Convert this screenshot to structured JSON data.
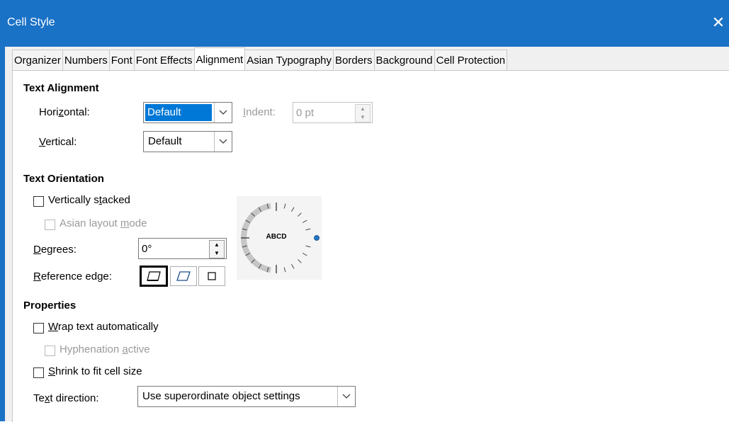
{
  "window": {
    "title": "Cell Style",
    "close_glyph": "✕"
  },
  "tabs": [
    {
      "label": "Organizer"
    },
    {
      "label": "Numbers"
    },
    {
      "label": "Font"
    },
    {
      "label": "Font Effects"
    },
    {
      "label": "Alignment",
      "active": true
    },
    {
      "label": "Asian Typography"
    },
    {
      "label": "Borders"
    },
    {
      "label": "Background"
    },
    {
      "label": "Cell Protection"
    }
  ],
  "text_alignment": {
    "heading": "Text Alignment",
    "horizontal_label_pre": "Hori",
    "horizontal_label_key": "z",
    "horizontal_label_post": "ontal:",
    "horizontal_value": "Default",
    "indent_label_pre": "",
    "indent_label_key": "I",
    "indent_label_post": "ndent:",
    "indent_value": "0 pt",
    "vertical_label_pre": "",
    "vertical_label_key": "V",
    "vertical_label_post": "ertical:",
    "vertical_value": "Default"
  },
  "text_orientation": {
    "heading": "Text Orientation",
    "vertically_stacked_pre": "Vertically s",
    "vertically_stacked_key": "t",
    "vertically_stacked_post": "acked",
    "asian_layout_pre": "Asian layout ",
    "asian_layout_key": "m",
    "asian_layout_post": "ode",
    "degrees_label_pre": "",
    "degrees_label_key": "D",
    "degrees_label_post": "egrees:",
    "degrees_value": "0°",
    "reference_edge_pre": "",
    "reference_edge_key": "R",
    "reference_edge_post": "eference edge:",
    "dial_text": "ABCD",
    "degrees": 0
  },
  "properties": {
    "heading": "Properties",
    "wrap_pre": "",
    "wrap_key": "W",
    "wrap_post": "rap text automatically",
    "hyphenation_pre": "Hyphenation ",
    "hyphenation_key": "a",
    "hyphenation_post": "ctive",
    "shrink_pre": "",
    "shrink_key": "S",
    "shrink_post": "hrink to fit cell size",
    "text_direction_pre": "Te",
    "text_direction_key": "x",
    "text_direction_post": "t direction:",
    "text_direction_value": "Use superordinate object settings"
  },
  "colors": {
    "titlebar": "#1a72c6",
    "selection": "#0078d7",
    "dial_marker": "#1e78c8"
  }
}
